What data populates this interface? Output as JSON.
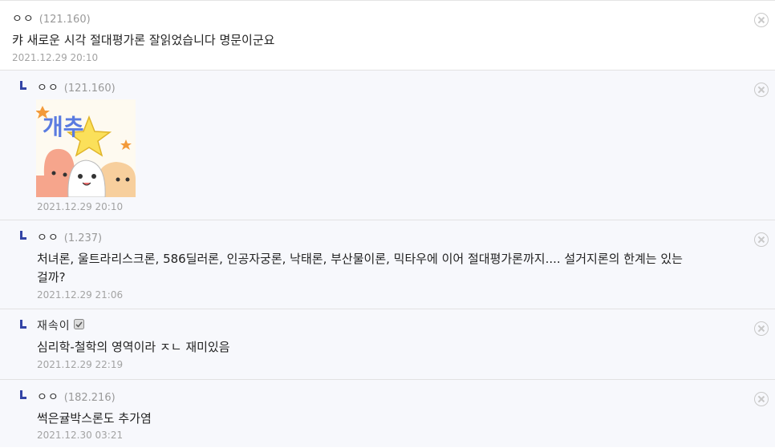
{
  "comments": [
    {
      "nick": "ㅇㅇ",
      "ip": "(121.160)",
      "text": "캬 새로운 시각 절대평가론 잘읽었습니다 명문이군요",
      "date": "2021.12.29 20:10"
    },
    {
      "nick": "ㅇㅇ",
      "ip": "(121.160)",
      "image_text": "개추",
      "date": "2021.12.29 20:10"
    },
    {
      "nick": "ㅇㅇ",
      "ip": "(1.237)",
      "text_line1": "처녀론, 울트라리스크론, 586딜러론, 인공자궁론, 낙태론, 부산물이론, 믹타우에 이어 절대평가론까지.... 설거지론의 한계는 있는",
      "text_line2": "걸까?",
      "date": "2021.12.29 21:06"
    },
    {
      "nick": "재속이",
      "icon": "member-badge-icon",
      "text": "심리학-철학의 영역이라 ㅈㄴ 재미있음",
      "date": "2021.12.29 22:19"
    },
    {
      "nick": "ㅇㅇ",
      "ip": "(182.216)",
      "text": "썩은귤박스론도 추가염",
      "date": "2021.12.30 03:21"
    }
  ],
  "colors": {
    "reply_bg": "#f7f8fc",
    "reply_arrow": "#3344a6",
    "date": "#a3a3a3",
    "ip": "#999999"
  }
}
